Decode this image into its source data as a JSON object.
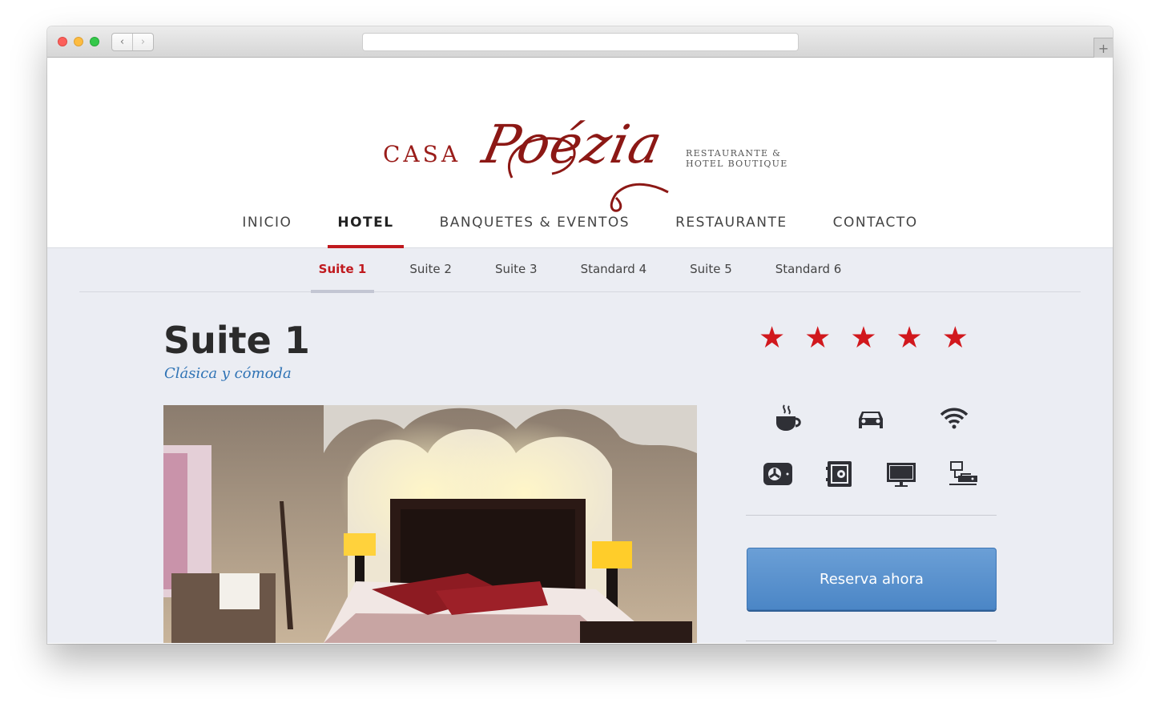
{
  "browser": {
    "back_symbol": "‹",
    "forward_symbol": "›",
    "new_tab_symbol": "+",
    "url": ""
  },
  "brand": {
    "casa": "CASA",
    "script": "Poézia",
    "tagline_1": "RESTAURANTE &",
    "tagline_2": "HOTEL BOUTIQUE",
    "color": "#9a1d1a"
  },
  "main_nav": {
    "items": [
      {
        "label": "INICIO"
      },
      {
        "label": "HOTEL",
        "active": true
      },
      {
        "label": "BANQUETES & EVENTOS"
      },
      {
        "label": "RESTAURANTE"
      },
      {
        "label": "CONTACTO"
      }
    ],
    "accent": "#c0191e"
  },
  "sub_nav": {
    "items": [
      {
        "label": "Suite 1",
        "active": true
      },
      {
        "label": "Suite 2"
      },
      {
        "label": "Suite 3"
      },
      {
        "label": "Standard 4"
      },
      {
        "label": "Suite 5"
      },
      {
        "label": "Standard 6"
      }
    ]
  },
  "room": {
    "title": "Suite 1",
    "subtitle": "Clásica y cómoda",
    "rating": 5,
    "star_color": "#d1181d",
    "amenities_row1": [
      "coffee-icon",
      "car-icon",
      "wifi-icon"
    ],
    "amenities_row2": [
      "air-conditioning-icon",
      "safe-icon",
      "tv-icon",
      "network-icon"
    ]
  },
  "cta": {
    "book_label": "Reserva ahora",
    "color": "#5b93cf"
  }
}
